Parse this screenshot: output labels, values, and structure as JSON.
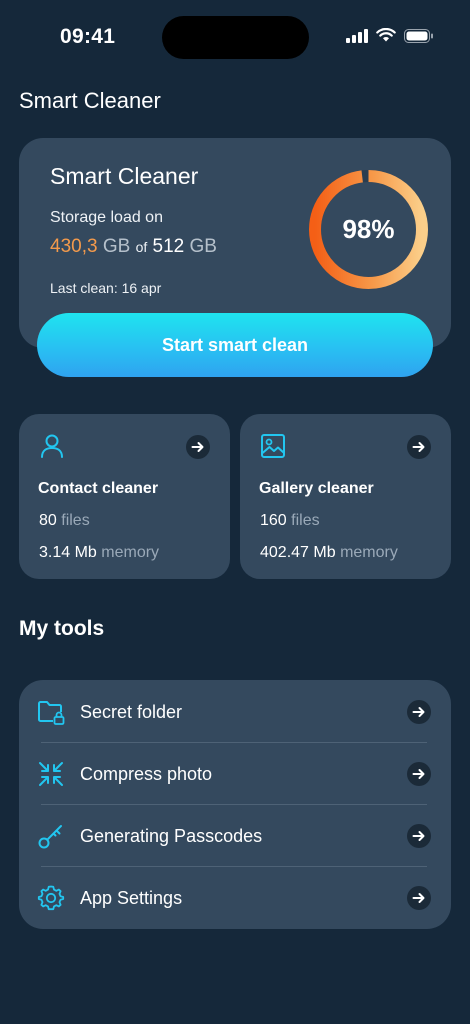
{
  "status_bar": {
    "time": "09:41",
    "icons": [
      "cellular-signal-icon",
      "wifi-icon",
      "battery-icon"
    ]
  },
  "app_title": "Smart Cleaner",
  "storage_card": {
    "title": "Smart Cleaner",
    "subtitle": "Storage load on",
    "used_value": "430,3",
    "used_unit": "GB",
    "of_label": "of",
    "total_value": "512",
    "total_unit": "GB",
    "last_clean": "Last clean: 16 apr",
    "percent_label": "98%",
    "percent_value": 0.98,
    "button_label": "Start smart clean"
  },
  "cleaners": [
    {
      "title": "Contact cleaner",
      "icon": "contact-icon",
      "count": "80",
      "count_label": "files",
      "size": "3.14 Mb",
      "size_label": "memory"
    },
    {
      "title": "Gallery cleaner",
      "icon": "gallery-icon",
      "count": "160",
      "count_label": "files",
      "size": "402.47 Mb",
      "size_label": "memory"
    }
  ],
  "tools": {
    "title": "My tools",
    "items": [
      {
        "label": "Secret folder",
        "icon": "locked-folder-icon"
      },
      {
        "label": "Compress photo",
        "icon": "compress-icon"
      },
      {
        "label": "Generating Passcodes",
        "icon": "key-icon"
      },
      {
        "label": "App Settings",
        "icon": "gear-icon"
      }
    ]
  },
  "colors": {
    "background": "#15283a",
    "card": "#34495e",
    "accent_cyan": "#1fd8f0",
    "accent_orange": "#f39a4c",
    "arrow_bubble": "#1b2a38"
  }
}
